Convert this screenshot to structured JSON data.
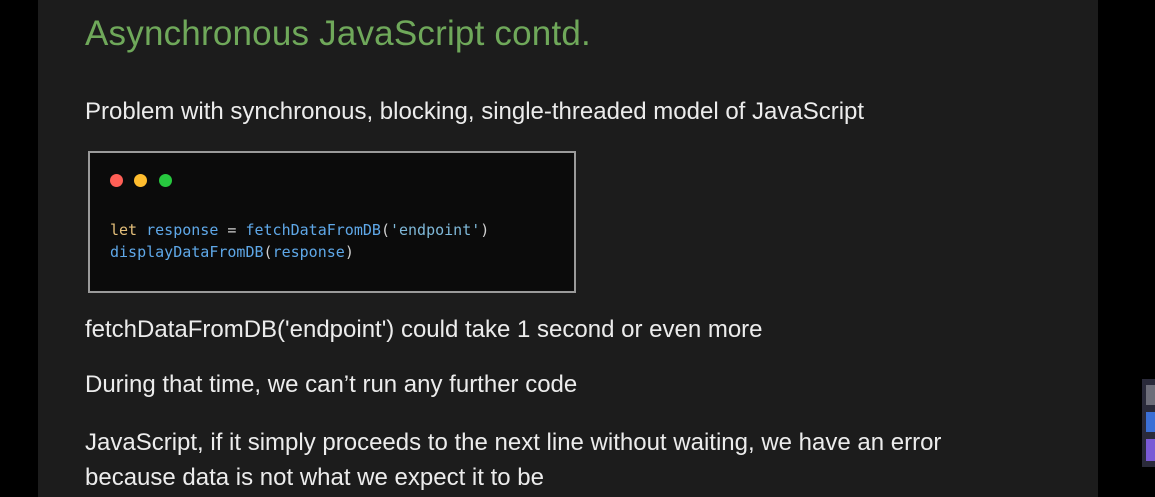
{
  "slide": {
    "title": "Asynchronous JavaScript contd.",
    "subtitle": "Problem with synchronous, blocking, single-threaded model of JavaScript",
    "code": {
      "line1": {
        "keyword": "let",
        "variable": "response",
        "operator": "=",
        "function": "fetchDataFromDB",
        "open": "(",
        "string": "'endpoint'",
        "close": ")"
      },
      "line2": {
        "function": "displayDataFromDB",
        "open": "(",
        "argument": "response",
        "close": ")"
      }
    },
    "paragraphs": {
      "p1": "fetchDataFromDB('endpoint') could take 1 second or even more",
      "p2": "During that time, we can’t run any further code",
      "p3_line1": "JavaScript, if it simply proceeds to the next line without waiting, we have an error",
      "p3_line2": "because data is not what we expect it to be"
    }
  },
  "colors": {
    "title": "#6fa85a",
    "background": "#1c1c1c",
    "dot_red": "#ff5f56",
    "dot_yellow": "#ffbd2e",
    "dot_green": "#27c93f"
  }
}
